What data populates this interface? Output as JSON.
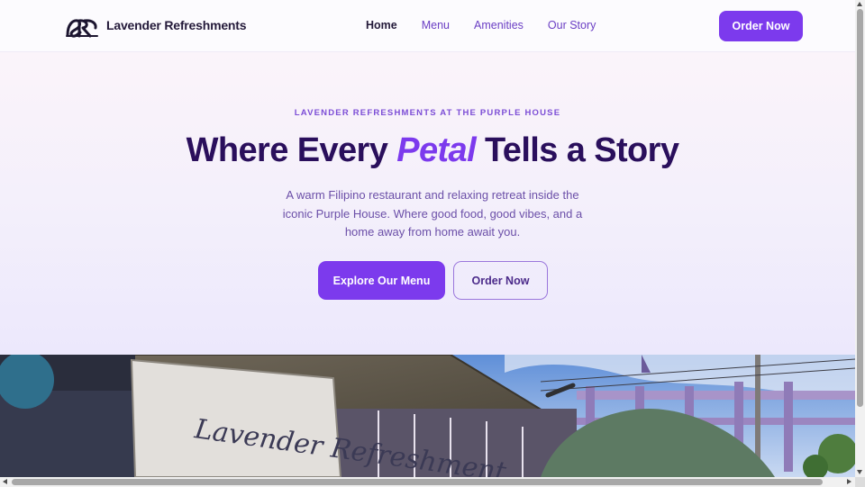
{
  "nav": {
    "brand": "Lavender Refreshments",
    "links": [
      {
        "label": "Home",
        "active": true
      },
      {
        "label": "Menu",
        "active": false
      },
      {
        "label": "Amenities",
        "active": false
      },
      {
        "label": "Our Story",
        "active": false
      }
    ],
    "order_label": "Order Now",
    "logo_icon": "lr-monogram-icon"
  },
  "hero": {
    "eyebrow": "LAVENDER REFRESHMENTS AT THE PURPLE HOUSE",
    "headline_before": "Where Every ",
    "headline_accent": "Petal",
    "headline_after": " Tells a Story",
    "subtext": "A warm Filipino restaurant and relaxing retreat inside the iconic Purple House. Where good food, good vibes, and a home away from home await you.",
    "primary_cta": "Explore Our Menu",
    "secondary_cta": "Order Now"
  },
  "photo": {
    "sign_text": "Lavender Refreshment"
  },
  "colors": {
    "accent": "#7c3aed",
    "headline": "#2a0f5c",
    "subtext": "#6b4fa8"
  }
}
